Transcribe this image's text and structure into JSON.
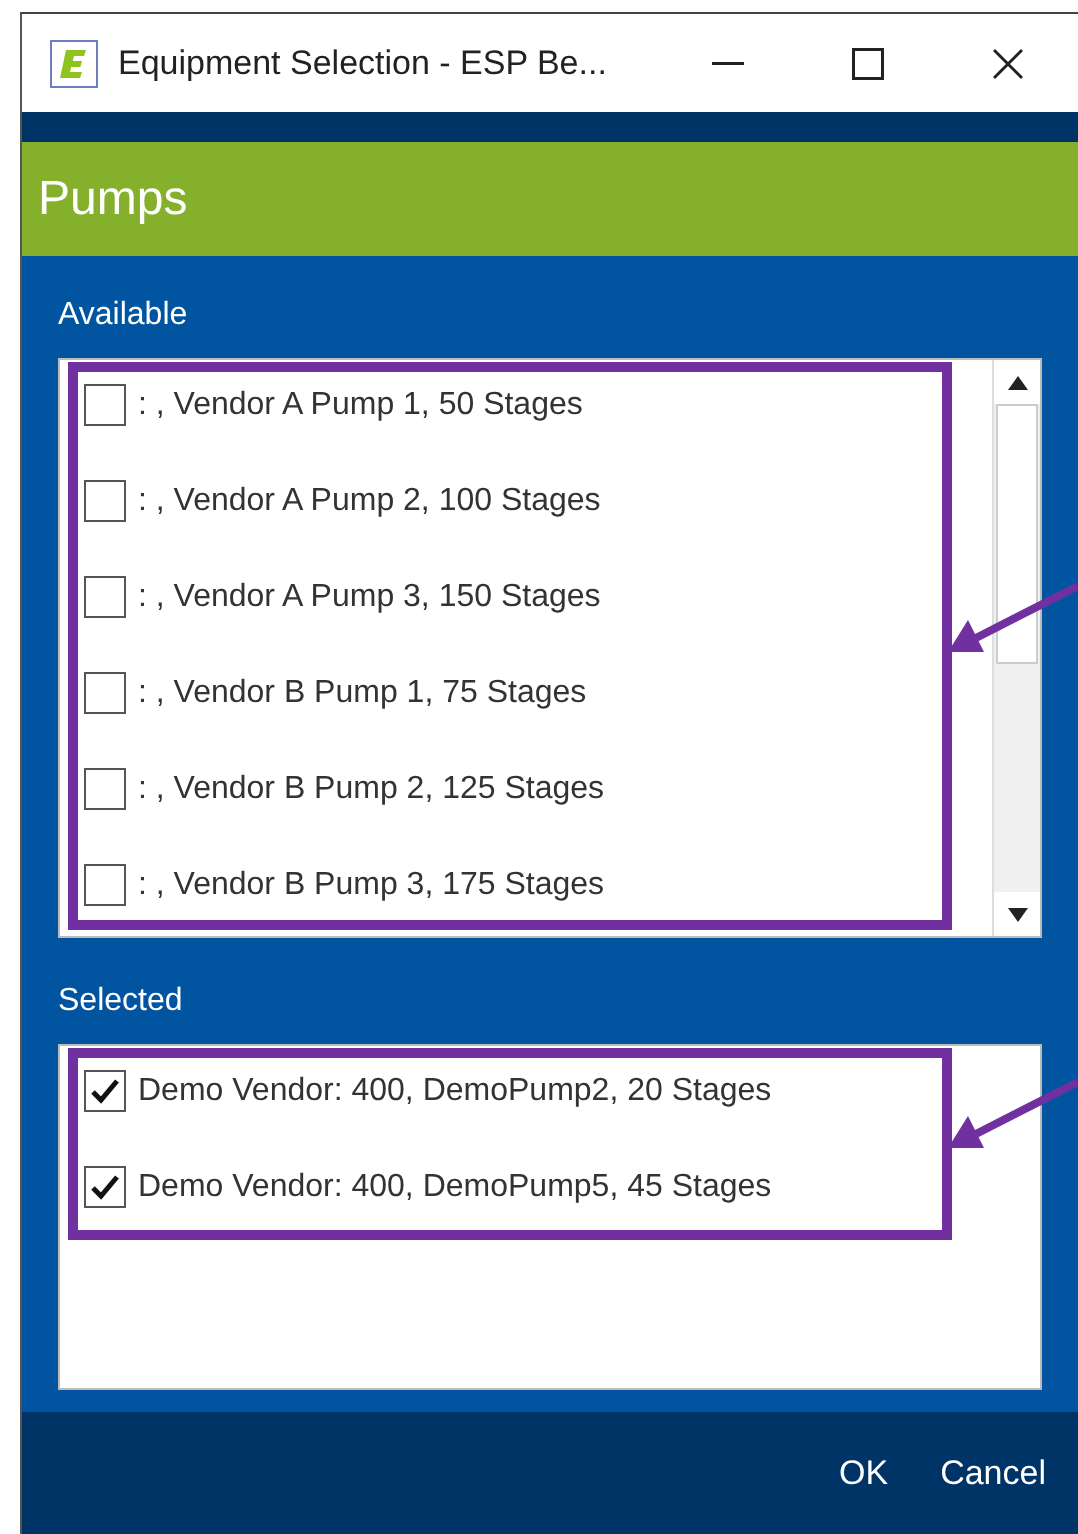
{
  "window": {
    "title": "Equipment Selection - ESP Be..."
  },
  "header": {
    "title": "Pumps"
  },
  "available": {
    "label": "Available",
    "items": [
      {
        "text": ": , Vendor A Pump 1, 50 Stages",
        "checked": false
      },
      {
        "text": ": , Vendor A Pump 2, 100 Stages",
        "checked": false
      },
      {
        "text": ": , Vendor A Pump 3, 150 Stages",
        "checked": false
      },
      {
        "text": ": , Vendor B Pump 1, 75 Stages",
        "checked": false
      },
      {
        "text": ": , Vendor B Pump 2, 125 Stages",
        "checked": false
      },
      {
        "text": ": , Vendor B Pump 3, 175 Stages",
        "checked": false
      }
    ]
  },
  "selected": {
    "label": "Selected",
    "items": [
      {
        "text": "Demo Vendor: 400, DemoPump2, 20 Stages",
        "checked": true
      },
      {
        "text": "Demo Vendor: 400, DemoPump5, 45 Stages",
        "checked": true
      }
    ]
  },
  "buttons": [
    "OK",
    "Cancel"
  ]
}
